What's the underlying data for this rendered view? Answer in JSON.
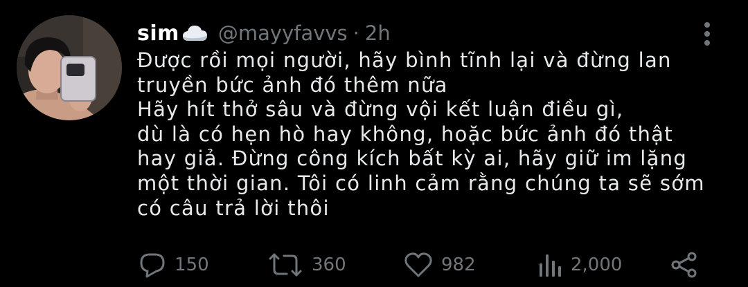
{
  "tweet": {
    "display_name": "sim",
    "name_emoji_icon": "cloud-icon",
    "handle": "@mayyfavvs",
    "separator": "·",
    "time": "2h",
    "text": "Được rồi mọi người, hãy bình tĩnh lại và đừng lan\ntruyền bức ảnh đó thêm nữa\nHãy hít thở sâu và đừng vội kết luận điều gì,\ndù là có hẹn hò hay không, hoặc bức ảnh đó thật\nhay giả. Đừng công kích bất kỳ ai, hãy giữ im lặng\nmột thời gian. Tôi có linh cảm rằng chúng ta sẽ sớm\ncó câu trả lời thôi"
  },
  "actions": {
    "replies": {
      "icon": "reply-icon",
      "count": "150"
    },
    "retweets": {
      "icon": "retweet-icon",
      "count": "360"
    },
    "likes": {
      "icon": "heart-icon",
      "count": "982"
    },
    "views": {
      "icon": "views-icon",
      "count": "2,000"
    },
    "share": {
      "icon": "share-icon"
    }
  },
  "colors": {
    "background": "#000000",
    "text_primary": "#e7e9ea",
    "text_secondary": "#71767b"
  }
}
